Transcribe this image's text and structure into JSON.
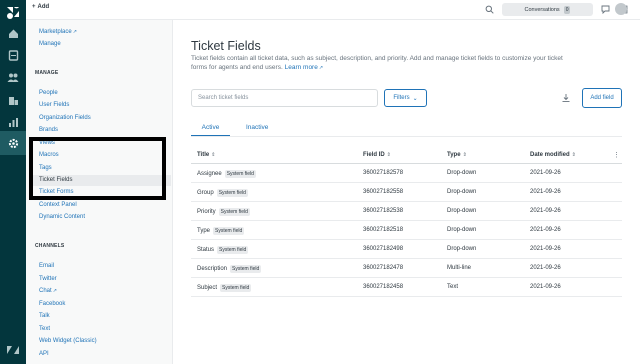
{
  "topbar": {
    "add_label": "Add",
    "conversations_label": "Conversations",
    "conversations_count": "0"
  },
  "sidebar": {
    "links_top": [
      "Marketplace",
      "Manage"
    ],
    "manage_heading": "MANAGE",
    "manage_items": [
      "People",
      "User Fields",
      "Organization Fields",
      "Brands",
      "Views",
      "Macros",
      "Tags",
      "Ticket Fields",
      "Ticket Forms",
      "Context Panel",
      "Dynamic Content"
    ],
    "selected_item": "Ticket Fields",
    "channels_heading": "CHANNELS",
    "channel_items": [
      "Email",
      "Twitter",
      "Chat",
      "Facebook",
      "Talk",
      "Text",
      "Web Widget (Classic)",
      "API"
    ]
  },
  "main": {
    "title": "Ticket Fields",
    "description": "Ticket fields contain all ticket data, such as subject, description, and priority. Add and manage ticket fields to customize your ticket forms for agents and end users.",
    "learn_more": "Learn more",
    "search_placeholder": "Search ticket fields",
    "filters_label": "Filters",
    "add_field_label": "Add field",
    "tabs": [
      "Active",
      "Inactive"
    ],
    "columns": [
      "Title",
      "Field ID",
      "Type",
      "Date modified"
    ],
    "system_tag": "System field",
    "rows": [
      {
        "title": "Assignee",
        "field_id": "360027182578",
        "type": "Drop-down",
        "date": "2021-09-26"
      },
      {
        "title": "Group",
        "field_id": "360027182558",
        "type": "Drop-down",
        "date": "2021-09-26"
      },
      {
        "title": "Priority",
        "field_id": "360027182538",
        "type": "Drop-down",
        "date": "2021-09-26"
      },
      {
        "title": "Type",
        "field_id": "360027182518",
        "type": "Drop-down",
        "date": "2021-09-26"
      },
      {
        "title": "Status",
        "field_id": "360027182498",
        "type": "Drop-down",
        "date": "2021-09-26"
      },
      {
        "title": "Description",
        "field_id": "360027182478",
        "type": "Multi-line",
        "date": "2021-09-26"
      },
      {
        "title": "Subject",
        "field_id": "360027182458",
        "type": "Text",
        "date": "2021-09-26"
      }
    ]
  },
  "colors": {
    "rail": "#03363d",
    "link": "#1f73b7",
    "text": "#2f3941"
  },
  "icons": [
    "zendesk-logo-icon",
    "home-icon",
    "views-icon",
    "customers-icon",
    "organizations-icon",
    "reporting-icon",
    "gear-icon",
    "search-icon",
    "chat-icon",
    "apps-grid-icon",
    "avatar",
    "download-icon",
    "kebab-icon"
  ]
}
